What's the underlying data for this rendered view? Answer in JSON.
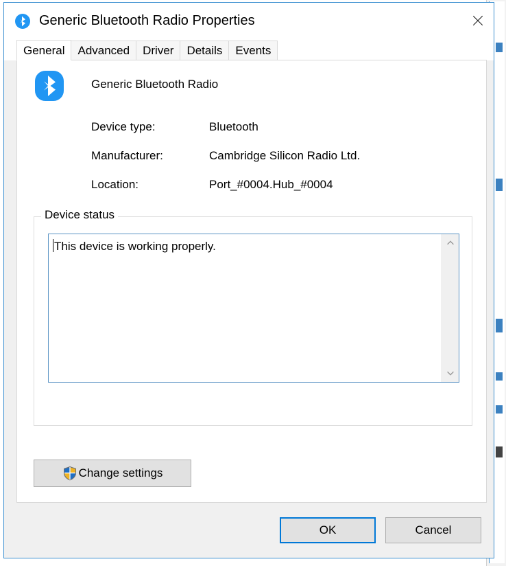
{
  "window": {
    "title": "Generic Bluetooth Radio Properties",
    "title_icon": "bluetooth-icon",
    "close_label": "✕"
  },
  "tabs": [
    {
      "label": "General",
      "active": true
    },
    {
      "label": "Advanced",
      "active": false
    },
    {
      "label": "Driver",
      "active": false
    },
    {
      "label": "Details",
      "active": false
    },
    {
      "label": "Events",
      "active": false
    }
  ],
  "device": {
    "icon": "bluetooth-icon",
    "name": "Generic Bluetooth Radio",
    "properties": [
      {
        "label": "Device type:",
        "value": "Bluetooth"
      },
      {
        "label": "Manufacturer:",
        "value": "Cambridge Silicon Radio Ltd."
      },
      {
        "label": "Location:",
        "value": "Port_#0004.Hub_#0004"
      }
    ]
  },
  "device_status": {
    "legend": "Device status",
    "text": "This device is working properly.",
    "scroll_up_icon": "chevron-up-icon",
    "scroll_down_icon": "chevron-down-icon"
  },
  "change_settings": {
    "label": "Change settings",
    "icon": "uac-shield-icon"
  },
  "footer": {
    "ok_label": "OK",
    "cancel_label": "Cancel"
  },
  "colors": {
    "accent": "#0078d7",
    "bluetooth_blue": "#2196f3",
    "dialog_bg": "#f0f0f0",
    "button_bg": "#e1e1e1",
    "textbox_border": "#5a93c4",
    "shield_blue": "#1f6fc4",
    "shield_yellow": "#f0b323"
  }
}
